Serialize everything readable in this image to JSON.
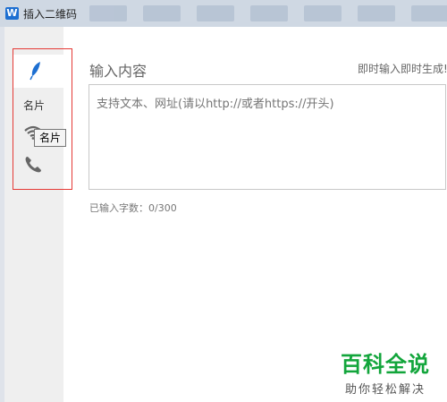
{
  "window": {
    "title": "插入二维码",
    "app_icon_letter": "W"
  },
  "sidebar": {
    "items": [
      {
        "icon": "feather-icon",
        "active": true
      },
      {
        "label": "名片"
      },
      {
        "icon": "wifi-icon"
      },
      {
        "icon": "phone-icon"
      }
    ],
    "tooltip": "名片"
  },
  "main": {
    "heading": "输入内容",
    "hint": "即时输入即时生成!",
    "input": {
      "value": "",
      "placeholder": "支持文本、网址(请以http://或者https://开头)"
    },
    "char_count": "已输入字数：0/300"
  },
  "watermark": {
    "main": "百科全说",
    "sub": "助你轻松解决"
  },
  "colors": {
    "highlight_box": "#e53935",
    "accent_blue": "#1d6fd1",
    "watermark_green": "#12a53b"
  }
}
